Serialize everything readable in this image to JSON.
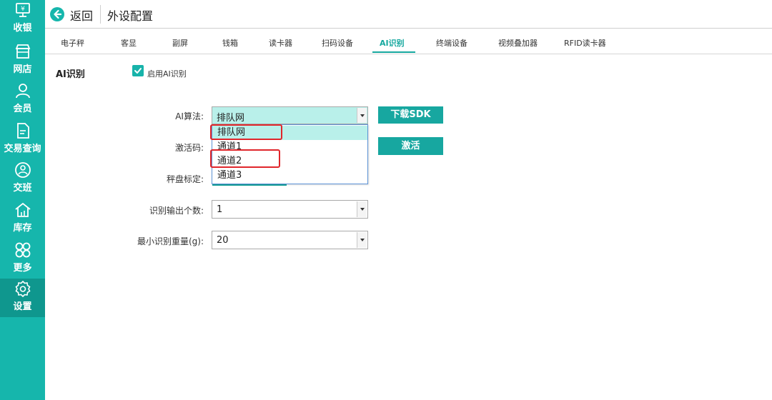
{
  "sidebar": {
    "items": [
      {
        "label": "收银",
        "icon": "cashier-icon"
      },
      {
        "label": "网店",
        "icon": "store-icon"
      },
      {
        "label": "会员",
        "icon": "member-icon"
      },
      {
        "label": "交易查询",
        "icon": "document-icon"
      },
      {
        "label": "交班",
        "icon": "shift-icon"
      },
      {
        "label": "库存",
        "icon": "inventory-icon"
      },
      {
        "label": "更多",
        "icon": "more-icon"
      },
      {
        "label": "设置",
        "icon": "settings-icon"
      }
    ],
    "active": "设置"
  },
  "header": {
    "back_label": "返回",
    "title": "外设配置"
  },
  "tabs": [
    {
      "label": "电子秤"
    },
    {
      "label": "客显"
    },
    {
      "label": "副屏"
    },
    {
      "label": "钱箱"
    },
    {
      "label": "读卡器"
    },
    {
      "label": "扫码设备"
    },
    {
      "label": "AI识别"
    },
    {
      "label": "终端设备"
    },
    {
      "label": "视频叠加器"
    },
    {
      "label": "RFID读卡器"
    }
  ],
  "active_tab": "AI识别",
  "section": {
    "title": "AI识别",
    "enable_label": "启用AI识别",
    "enable_checked": true
  },
  "form": {
    "algorithm_label": "AI算法:",
    "algorithm_value": "排队网",
    "download_sdk_label": "下载SDK",
    "activation_label": "激活码:",
    "activate_label": "激活",
    "calibration_label": "秤盘标定:",
    "output_count_label": "识别输出个数:",
    "output_count_value": "1",
    "min_weight_label": "最小识别重量(g):",
    "min_weight_value": "20"
  },
  "dropdown": {
    "options": [
      "排队网",
      "通道1",
      "通道2",
      "通道3"
    ],
    "selected": "排队网"
  },
  "colors": {
    "sidebar": "#16b6ac",
    "accent": "#17a7a0",
    "highlight": "#e0262b"
  }
}
